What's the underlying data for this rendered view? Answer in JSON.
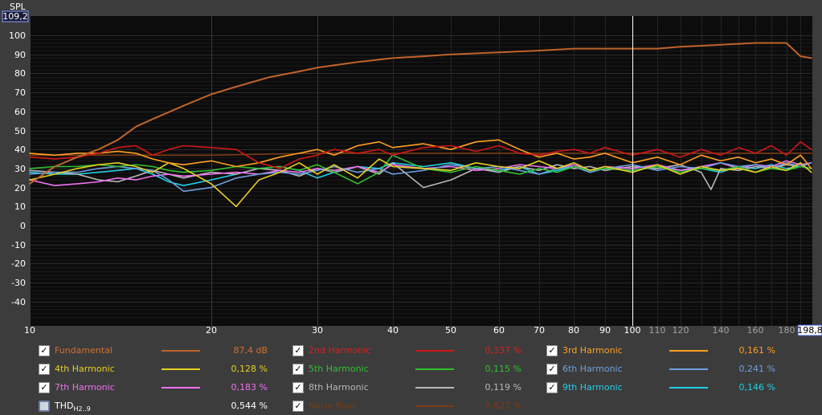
{
  "chart_data": {
    "type": "line",
    "ylabel": "SPL",
    "y_readout": "109,2",
    "x_readout": "198,8",
    "xlim": [
      10,
      198.8
    ],
    "ylim": [
      -50,
      109.2
    ],
    "x_scale": "log",
    "grid": true,
    "yticks": [
      "100",
      "90",
      "80",
      "70",
      "60",
      "50",
      "40",
      "30",
      "20",
      "10",
      "0",
      "-10",
      "-20",
      "-30",
      "-40"
    ],
    "xticks": [
      "10",
      "20",
      "30",
      "40",
      "50",
      "60",
      "70",
      "80",
      "90",
      "100",
      "110",
      "120",
      "140",
      "160",
      "180"
    ],
    "cursor_x": 100,
    "series": [
      {
        "name": "Fundamental",
        "color": "#c0632a",
        "x": [
          10,
          11,
          12,
          13,
          14,
          15,
          16,
          18,
          20,
          22,
          25,
          28,
          30,
          35,
          40,
          45,
          50,
          60,
          70,
          80,
          90,
          100,
          110,
          120,
          140,
          160,
          180,
          190,
          198
        ],
        "y": [
          22,
          31,
          36,
          40,
          45,
          52,
          56,
          63,
          69,
          73,
          78,
          81,
          83,
          86,
          88,
          89,
          90,
          91,
          92,
          93,
          93,
          93,
          93,
          94,
          95,
          96,
          96,
          89,
          88
        ]
      },
      {
        "name": "2nd Harmonic",
        "color": "#d01818",
        "x": [
          10,
          11,
          12,
          13,
          14,
          15,
          16,
          17,
          18,
          20,
          22,
          24,
          26,
          28,
          30,
          32,
          35,
          38,
          40,
          45,
          50,
          55,
          60,
          65,
          70,
          75,
          80,
          85,
          90,
          100,
          110,
          120,
          130,
          140,
          150,
          160,
          170,
          180,
          190,
          198
        ],
        "y": [
          36,
          35,
          36,
          38,
          41,
          42,
          37,
          40,
          42,
          41,
          40,
          33,
          30,
          35,
          37,
          40,
          38,
          40,
          37,
          41,
          42,
          39,
          42,
          38,
          37,
          39,
          40,
          38,
          41,
          37,
          40,
          36,
          40,
          37,
          41,
          38,
          42,
          37,
          44,
          40
        ]
      },
      {
        "name": "3rd Harmonic",
        "color": "#ffa020",
        "x": [
          10,
          11,
          12,
          13,
          14,
          15,
          16,
          17,
          18,
          20,
          22,
          24,
          26,
          28,
          30,
          32,
          35,
          38,
          40,
          45,
          50,
          55,
          60,
          65,
          70,
          75,
          80,
          85,
          90,
          100,
          110,
          120,
          130,
          140,
          150,
          160,
          170,
          180,
          190,
          198
        ],
        "y": [
          38,
          37,
          38,
          38,
          39,
          38,
          35,
          33,
          32,
          34,
          31,
          33,
          36,
          38,
          40,
          37,
          42,
          44,
          41,
          43,
          40,
          44,
          45,
          40,
          36,
          38,
          35,
          36,
          38,
          33,
          36,
          32,
          37,
          34,
          36,
          33,
          35,
          32,
          37,
          30
        ]
      },
      {
        "name": "4th Harmonic",
        "color": "#e6d020",
        "x": [
          10,
          11,
          12,
          13,
          14,
          15,
          16,
          17,
          18,
          20,
          22,
          24,
          26,
          28,
          30,
          32,
          35,
          38,
          40,
          45,
          50,
          55,
          60,
          65,
          70,
          75,
          80,
          85,
          90,
          100,
          110,
          120,
          130,
          140,
          150,
          160,
          170,
          180,
          190,
          198
        ],
        "y": [
          24,
          27,
          30,
          32,
          33,
          31,
          28,
          33,
          30,
          22,
          10,
          24,
          28,
          33,
          27,
          32,
          25,
          35,
          31,
          30,
          29,
          33,
          31,
          30,
          34,
          30,
          33,
          29,
          31,
          28,
          32,
          27,
          31,
          29,
          30,
          28,
          31,
          29,
          33,
          28
        ]
      },
      {
        "name": "5th Harmonic",
        "color": "#30c030",
        "x": [
          10,
          11,
          12,
          13,
          14,
          15,
          16,
          17,
          18,
          20,
          22,
          24,
          26,
          28,
          30,
          32,
          35,
          38,
          40,
          45,
          50,
          55,
          60,
          65,
          70,
          75,
          80,
          85,
          90,
          100,
          110,
          120,
          130,
          140,
          150,
          160,
          170,
          180,
          190,
          198
        ],
        "y": [
          30,
          31,
          31,
          32,
          31,
          32,
          31,
          29,
          28,
          29,
          31,
          30,
          31,
          29,
          32,
          28,
          22,
          28,
          37,
          30,
          28,
          31,
          29,
          27,
          30,
          28,
          31,
          29,
          30,
          29,
          31,
          28,
          30,
          29,
          31,
          28,
          30,
          29,
          31,
          30
        ]
      },
      {
        "name": "6th Harmonic",
        "color": "#6ea0e0",
        "x": [
          10,
          11,
          12,
          13,
          14,
          15,
          16,
          17,
          18,
          20,
          22,
          24,
          26,
          28,
          30,
          32,
          35,
          38,
          40,
          45,
          50,
          55,
          60,
          65,
          70,
          75,
          80,
          85,
          90,
          100,
          110,
          120,
          130,
          140,
          150,
          160,
          170,
          180,
          190,
          198
        ],
        "y": [
          27,
          28,
          28,
          30,
          31,
          30,
          29,
          24,
          18,
          20,
          25,
          27,
          28,
          27,
          29,
          31,
          28,
          30,
          27,
          29,
          32,
          30,
          31,
          29,
          27,
          30,
          31,
          28,
          30,
          32,
          29,
          31,
          30,
          33,
          31,
          32,
          30,
          33,
          31,
          33
        ]
      },
      {
        "name": "7th Harmonic",
        "color": "#f070f0",
        "x": [
          10,
          11,
          12,
          13,
          14,
          15,
          16,
          17,
          18,
          20,
          22,
          24,
          26,
          28,
          30,
          32,
          35,
          38,
          40,
          45,
          50,
          55,
          60,
          65,
          70,
          75,
          80,
          85,
          90,
          100,
          110,
          120,
          130,
          140,
          150,
          160,
          170,
          180,
          190,
          198
        ],
        "y": [
          24,
          21,
          22,
          23,
          25,
          24,
          26,
          27,
          26,
          27,
          28,
          27,
          29,
          28,
          30,
          29,
          31,
          28,
          32,
          30,
          31,
          29,
          30,
          32,
          31,
          30,
          32,
          29,
          31,
          30,
          32,
          29,
          31,
          33,
          30,
          32,
          31,
          34,
          32,
          33
        ]
      },
      {
        "name": "8th Harmonic",
        "color": "#b8b8b8",
        "x": [
          10,
          11,
          12,
          13,
          14,
          15,
          16,
          17,
          18,
          20,
          22,
          24,
          26,
          28,
          30,
          32,
          35,
          38,
          40,
          45,
          50,
          55,
          60,
          65,
          70,
          75,
          80,
          85,
          90,
          100,
          110,
          120,
          130,
          135,
          140,
          150,
          160,
          170,
          180,
          190,
          198
        ],
        "y": [
          29,
          28,
          27,
          24,
          23,
          26,
          29,
          27,
          25,
          28,
          27,
          30,
          29,
          26,
          30,
          28,
          31,
          27,
          33,
          20,
          24,
          30,
          28,
          31,
          29,
          32,
          30,
          31,
          29,
          31,
          30,
          32,
          28,
          19,
          30,
          29,
          31,
          30,
          32,
          31,
          30
        ]
      },
      {
        "name": "9th Harmonic",
        "color": "#20d0e8",
        "x": [
          10,
          11,
          12,
          13,
          14,
          15,
          16,
          17,
          18,
          20,
          22,
          24,
          26,
          28,
          30,
          32,
          35,
          38,
          40,
          45,
          50,
          55,
          60,
          65,
          70,
          75,
          80,
          85,
          90,
          100,
          110,
          120,
          130,
          140,
          150,
          160,
          170,
          180,
          190,
          198
        ],
        "y": [
          28,
          27,
          27,
          28,
          29,
          30,
          27,
          23,
          21,
          24,
          27,
          30,
          31,
          29,
          25,
          28,
          31,
          30,
          33,
          31,
          33,
          30,
          29,
          31,
          27,
          29,
          31,
          28,
          30,
          29,
          31,
          29,
          30,
          28,
          31,
          30,
          32,
          30,
          31,
          33
        ]
      },
      {
        "name": "Noise floor",
        "color": "#7a3c14",
        "x": [
          10,
          20,
          30,
          40,
          50,
          60,
          70,
          80,
          100,
          120,
          150,
          198
        ],
        "y": [
          37,
          37,
          38,
          38,
          38,
          38,
          38,
          38,
          38,
          38,
          38,
          38
        ]
      }
    ]
  },
  "legend": [
    {
      "name": "Fundamental",
      "value": "87,4 dB",
      "checked": true,
      "color": "#c0632a",
      "text_color": "#d07030"
    },
    {
      "name": "2nd Harmonic",
      "value": "0,337 %",
      "checked": true,
      "color": "#d01818",
      "text_color": "#d82020"
    },
    {
      "name": "3rd Harmonic",
      "value": "0,161 %",
      "checked": true,
      "color": "#ffa020",
      "text_color": "#ffa020"
    },
    {
      "name": "4th Harmonic",
      "value": "0,128 %",
      "checked": true,
      "color": "#e6d020",
      "text_color": "#e6d020"
    },
    {
      "name": "5th Harmonic",
      "value": "0,115 %",
      "checked": true,
      "color": "#30c030",
      "text_color": "#30c030"
    },
    {
      "name": "6th Harmonic",
      "value": "0,241 %",
      "checked": true,
      "color": "#6ea0e0",
      "text_color": "#6ea0e0"
    },
    {
      "name": "7th Harmonic",
      "value": "0,183 %",
      "checked": true,
      "color": "#f070f0",
      "text_color": "#f070f0"
    },
    {
      "name": "8th Harmonic",
      "value": "0,119 %",
      "checked": true,
      "color": "#b8b8b8",
      "text_color": "#b8b8b8"
    },
    {
      "name": "9th Harmonic",
      "value": "0,146 %",
      "checked": true,
      "color": "#20d0e8",
      "text_color": "#20d0e8"
    },
    {
      "name": "THD",
      "sub": "H2..9",
      "value": "0,544 %",
      "checked": false,
      "color": "",
      "text_color": "#ffffff"
    },
    {
      "name": "Noise floor",
      "value": "0,627 %",
      "checked": true,
      "color": "#7a3c14",
      "text_color": "#7a3c14"
    }
  ],
  "check_glyph": "✓"
}
